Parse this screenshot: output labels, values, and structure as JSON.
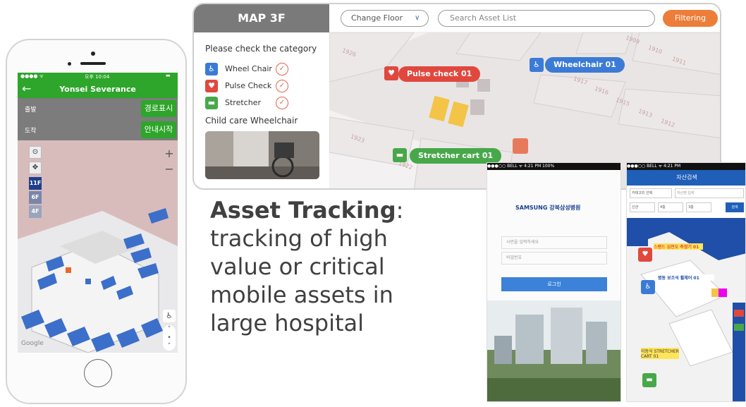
{
  "phone": {
    "status": {
      "carrier": "●●●● ᯤ",
      "time": "오후 10:04",
      "battery": "▬"
    },
    "title": "Yonsei Severance",
    "back_icon": "arrow-left-icon",
    "route": [
      {
        "label": "출발",
        "button": "경로표시"
      },
      {
        "label": "도착",
        "button": "안내시작"
      }
    ],
    "controls": {
      "zoom_in": "+",
      "zoom_out": "−",
      "floors": [
        "11F",
        "6F",
        "4F"
      ]
    },
    "attribution": "Google"
  },
  "desktop": {
    "map_title": "MAP 3F",
    "change_floor": "Change Floor",
    "search_placeholder": "Search Asset List",
    "filter_button": "Filtering",
    "category_heading": "Please check the category",
    "categories": [
      {
        "name": "Wheel Chair",
        "icon": "wheelchair-icon",
        "color": "#3b7bd6"
      },
      {
        "name": "Pulse Check",
        "icon": "heart-pulse-icon",
        "color": "#e0483e"
      },
      {
        "name": "Stretcher",
        "icon": "stretcher-icon",
        "color": "#47a84a"
      }
    ],
    "child_heading": "Child care Wheelchair",
    "markers": [
      {
        "label": "Pulse check 01",
        "color": "#e0483e"
      },
      {
        "label": "Wheelchair 01",
        "color": "#3b7bd6"
      },
      {
        "label": "Stretcher cart 01",
        "color": "#47a84a"
      }
    ],
    "room_numbers": [
      "1926",
      "1909",
      "1910",
      "1911",
      "1917",
      "1916",
      "1915",
      "1913",
      "1912",
      "1923",
      "1922"
    ]
  },
  "headline": {
    "bold": "Asset Tracking",
    "rest": ": tracking of high value or critical mobile assets in large hospital"
  },
  "login_phone": {
    "status": "●●●○○ BELL ᯤ   4:21 PM   100%",
    "brand": "SAMSUNG 강북삼성병원",
    "id_placeholder": "사번을 입력하세요",
    "pw_placeholder": "비밀번호",
    "login_button": "로그인"
  },
  "asset_phone": {
    "status": "●●●○○ BELL ᯤ   4:21 PM",
    "title": "자산검색",
    "filters": [
      "카테고리 선택",
      "자산명 입력",
      "신관",
      "4층",
      "3층",
      "검색"
    ],
    "labels": [
      "스탠드 심전도 측정기 01",
      "병동 보조석 휠체어 01",
      "이동식 STRETCHER CART 01"
    ]
  },
  "colors": {
    "green": "#2ea52b",
    "orange": "#ec7e3a",
    "blue": "#3b7bd6",
    "red": "#e0483e",
    "nav": "#1f5fb8"
  }
}
